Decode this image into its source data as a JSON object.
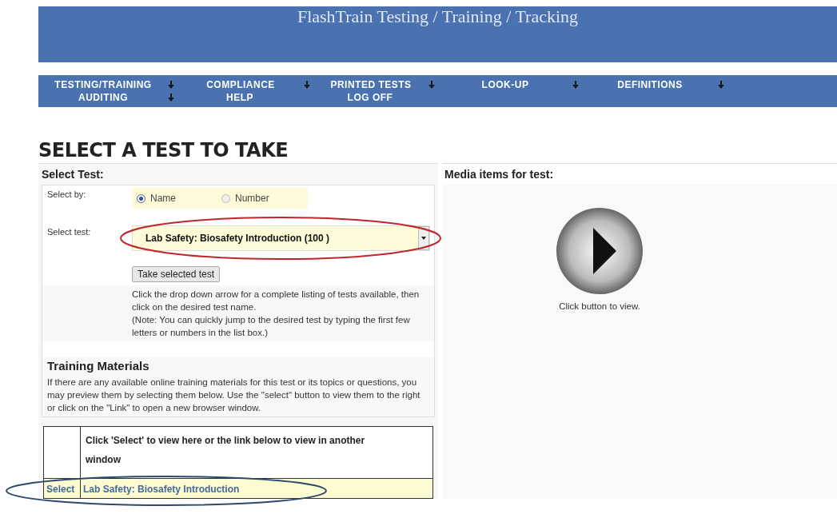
{
  "banner": {
    "title": "FlashTrain Testing / Training / Tracking"
  },
  "nav": {
    "rows": [
      [
        {
          "label": "TESTING/TRAINING",
          "has_submenu": true
        },
        {
          "label": "COMPLIANCE",
          "has_submenu": true
        },
        {
          "label": "PRINTED TESTS",
          "has_submenu": true
        },
        {
          "label": "LOOK-UP",
          "has_submenu": true
        },
        {
          "label": "DEFINITIONS",
          "has_submenu": true
        }
      ],
      [
        {
          "label": "AUDITING",
          "has_submenu": true
        },
        {
          "label": "HELP",
          "has_submenu": false
        },
        {
          "label": "LOG OFF",
          "has_submenu": false
        }
      ]
    ]
  },
  "heading": "SELECT A TEST TO TAKE",
  "select_test": {
    "title": "Select Test:",
    "select_by_label": "Select by:",
    "options": [
      {
        "label": "Name",
        "selected": true
      },
      {
        "label": "Number",
        "selected": false
      }
    ],
    "select_test_label": "Select test:",
    "dropdown_value": "Lab Safety: Biosafety Introduction (100 )",
    "button": "Take selected test",
    "help_lines": [
      "Click the drop down arrow for a complete listing of tests available, then click on the desired test name.",
      "(Note:  You can quickly jump to the desired test by typing the first few letters or numbers in the list box.)"
    ]
  },
  "training": {
    "title": "Training Materials",
    "text": "If there are any available online training materials for this test or its topics or questions, you may preview them by selecting them below.  Use the \"select\" button to view them to the right or click on the \"Link\" to open a new browser window.",
    "table_header": "Click 'Select' to view here or the link below to view in another window",
    "rows": [
      {
        "select": "Select",
        "link": "Lab Safety: Biosafety Introduction"
      }
    ]
  },
  "media": {
    "title": "Media items for test:",
    "caption": "Click button to view."
  }
}
